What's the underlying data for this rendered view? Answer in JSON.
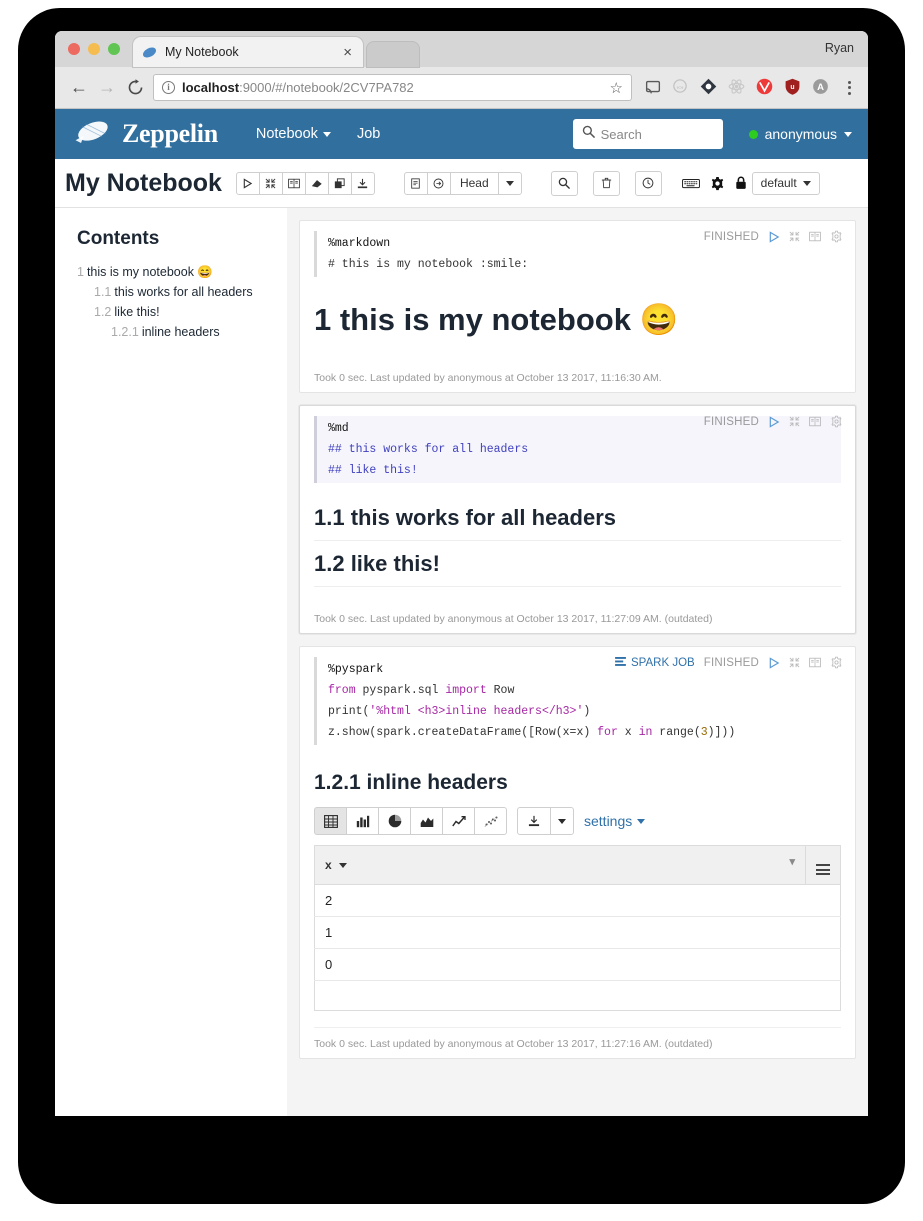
{
  "browser": {
    "profile_name": "Ryan",
    "tab": {
      "title": "My Notebook",
      "close_label": "×"
    },
    "url_host": "localhost",
    "url_rest": ":9000/#/notebook/2CV7PA782",
    "nav": {
      "back": "←",
      "forward": "→",
      "reload": "⟳"
    },
    "info_glyph": "i",
    "star_glyph": "☆"
  },
  "zeppelin_nav": {
    "brand": "Zeppelin",
    "links": [
      {
        "label": "Notebook",
        "has_caret": true
      },
      {
        "label": "Job",
        "has_caret": false
      }
    ],
    "search_placeholder": "Search",
    "user": "anonymous",
    "status_color": "#2ecc1f",
    "navbar_color": "#316f9e"
  },
  "notebook_toolbar": {
    "title": "My Notebook",
    "run_group": [
      "run-icon",
      "collapse-icon",
      "book-icon",
      "eraser-icon",
      "clone-icon",
      "export-icon"
    ],
    "revision_group": [
      "commit-icon",
      "revision-icon"
    ],
    "revision_label": "Head",
    "search_icon": "search-icon",
    "trash_icon": "trash-icon",
    "clock_icon": "clock-icon",
    "keyboard_icon": "keyboard-icon",
    "gear_icon": "gear-icon",
    "lock_icon": "lock-icon",
    "permissions_label": "default"
  },
  "toc": {
    "heading": "Contents",
    "items": [
      {
        "num": "1",
        "text": "this is my notebook 😄",
        "level": 1
      },
      {
        "num": "1.1",
        "text": "this works for all headers",
        "level": 2
      },
      {
        "num": "1.2",
        "text": "like this!",
        "level": 2
      },
      {
        "num": "1.2.1",
        "text": "inline headers",
        "level": 3
      }
    ]
  },
  "paragraphs": [
    {
      "interpreter": "%markdown",
      "code": "# this is my notebook :smile:",
      "status": "FINISHED",
      "selected": false,
      "spark_job": null,
      "output_heading": "1 this is my notebook 😄",
      "footer": "Took 0 sec. Last updated by anonymous at October 13 2017, 11:16:30 AM."
    },
    {
      "interpreter": "%md",
      "code_line1": "## this works for all headers",
      "code_line2": "## like this!",
      "status": "FINISHED",
      "selected": true,
      "spark_job": null,
      "output_heading_1": "1.1 this works for all headers",
      "output_heading_2": "1.2 like this!",
      "footer": "Took 0 sec. Last updated by anonymous at October 13 2017, 11:27:09 AM. (outdated)"
    },
    {
      "interpreter": "%pyspark",
      "code_import_kw": "from",
      "code_import_mod": " pyspark.sql ",
      "code_import_kw2": "import",
      "code_import_cls": " Row",
      "code_print_fn": "print(",
      "code_print_str": "'%html <h3>inline headers</h3>'",
      "code_print_end": ")",
      "code_show_a": "z.show(spark.createDataFrame([Row(x=x) ",
      "code_show_for": "for",
      "code_show_b": " x ",
      "code_show_in": "in",
      "code_show_c": " range(",
      "code_show_num": "3",
      "code_show_d": ")]))",
      "status": "FINISHED",
      "spark_job_label": "SPARK JOB",
      "selected": false,
      "output_heading": "1.2.1 inline headers",
      "footer": "Took 0 sec. Last updated by anonymous at October 13 2017, 11:27:16 AM. (outdated)"
    }
  ],
  "visualization": {
    "modes": [
      {
        "name": "table-chart-icon",
        "active": true
      },
      {
        "name": "bar-chart-icon",
        "active": false
      },
      {
        "name": "pie-chart-icon",
        "active": false
      },
      {
        "name": "area-chart-icon",
        "active": false
      },
      {
        "name": "line-chart-icon",
        "active": false
      },
      {
        "name": "scatter-chart-icon",
        "active": false
      }
    ],
    "download_icon": "download-icon",
    "settings_label": "settings"
  },
  "chart_data": {
    "type": "table",
    "title": "",
    "columns": [
      "x"
    ],
    "rows": [
      [
        "2"
      ],
      [
        "1"
      ],
      [
        "0"
      ],
      [
        ""
      ]
    ],
    "values": [
      2,
      1,
      0
    ]
  }
}
